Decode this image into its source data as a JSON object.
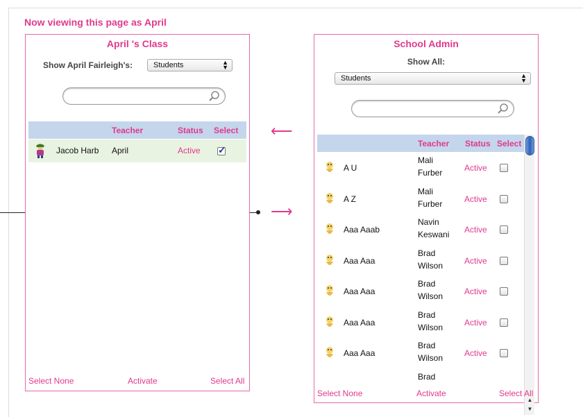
{
  "page_title": "Now viewing this page as April",
  "colors": {
    "accent": "#e0398d",
    "header_bg": "#c4d6ec",
    "selected_row_bg": "#e9f3e1",
    "border": "#e46aa8"
  },
  "left": {
    "title": "April 's Class",
    "show_label": "Show April Fairleigh's:",
    "select_value": "Students",
    "search_placeholder": "",
    "columns": {
      "teacher": "Teacher",
      "status": "Status",
      "select": "Select"
    },
    "rows": [
      {
        "name": "Jacob Harb",
        "teacher": "April",
        "status": "Active",
        "checked": true,
        "icon": "student-avatar-icon"
      }
    ],
    "footer": {
      "select_none": "Select None",
      "activate": "Activate",
      "select_all": "Select All"
    }
  },
  "right": {
    "title": "School Admin",
    "show_label": "Show All:",
    "select_value": "Students",
    "search_placeholder": "",
    "columns": {
      "teacher": "Teacher",
      "status": "Status",
      "select": "Select"
    },
    "rows": [
      {
        "name": "A U",
        "teacher1": "Mali",
        "teacher2": "Furber",
        "status": "Active",
        "checked": false
      },
      {
        "name": "A Z",
        "teacher1": "Mali",
        "teacher2": "Furber",
        "status": "Active",
        "checked": false
      },
      {
        "name": "Aaa Aaab",
        "teacher1": "Navin",
        "teacher2": "Keswani",
        "status": "Active",
        "checked": false
      },
      {
        "name": "Aaa Aaa",
        "teacher1": "Brad",
        "teacher2": "Wilson",
        "status": "Active",
        "checked": false
      },
      {
        "name": "Aaa Aaa",
        "teacher1": "Brad",
        "teacher2": "Wilson",
        "status": "Active",
        "checked": false
      },
      {
        "name": "Aaa Aaa",
        "teacher1": "Brad",
        "teacher2": "Wilson",
        "status": "Active",
        "checked": false
      },
      {
        "name": "Aaa Aaa",
        "teacher1": "Brad",
        "teacher2": "Wilson",
        "status": "Active",
        "checked": false
      },
      {
        "name": "",
        "teacher1": "Brad",
        "teacher2": "",
        "status": "",
        "checked": false
      }
    ],
    "footer": {
      "select_none": "Select None",
      "activate": "Activate",
      "select_all": "Select All"
    }
  },
  "arrows": {
    "left_arrow": "⟵",
    "right_arrow": "⟶"
  }
}
